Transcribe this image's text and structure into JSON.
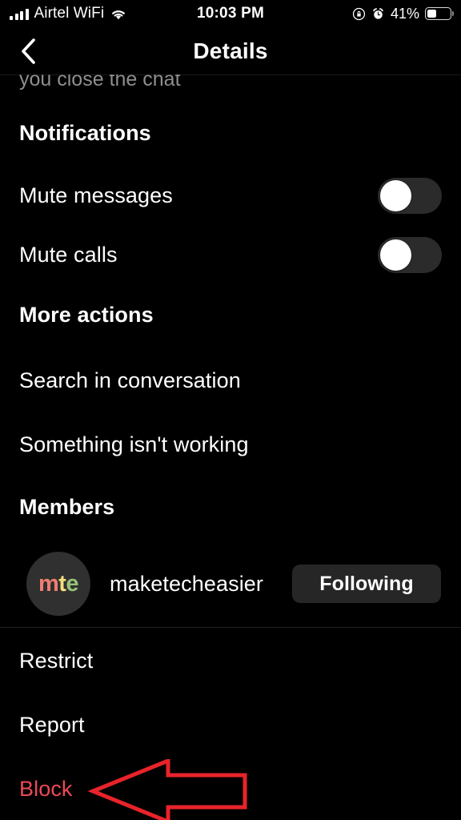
{
  "status_bar": {
    "carrier": "Airtel WiFi",
    "time": "10:03 PM",
    "battery_percent": "41%",
    "battery_level": 41,
    "icons": [
      "cellular-signal-icon",
      "wifi-icon",
      "orientation-lock-icon",
      "alarm-clock-icon",
      "battery-icon"
    ]
  },
  "header": {
    "title": "Details",
    "back_icon": "chevron-left-icon"
  },
  "content": {
    "clipped_text": "you close the chat",
    "sections": [
      {
        "heading": "Notifications",
        "rows": [
          {
            "label": "Mute messages",
            "control": "toggle",
            "value": "off"
          },
          {
            "label": "Mute calls",
            "control": "toggle",
            "value": "off"
          }
        ]
      },
      {
        "heading": "More actions",
        "rows": [
          {
            "label": "Search in conversation",
            "control": "none"
          },
          {
            "label": "Something isn't working",
            "control": "none"
          }
        ]
      },
      {
        "heading": "Members",
        "member": {
          "avatar_initials": [
            "m",
            "t",
            "e"
          ],
          "username": "maketecheasier",
          "follow_state": "Following"
        }
      }
    ],
    "footer_actions": [
      {
        "label": "Restrict",
        "style": "normal"
      },
      {
        "label": "Report",
        "style": "normal"
      },
      {
        "label": "Block",
        "style": "danger"
      }
    ]
  },
  "annotation": {
    "type": "arrow",
    "direction": "left",
    "color": "#e8232a",
    "points_to": "Block"
  },
  "colors": {
    "background": "#000000",
    "text_primary": "#ffffff",
    "text_secondary": "#8e8e8e",
    "danger": "#ed4956",
    "button_bg": "#262626",
    "toggle_track": "#2b2b2b",
    "annotation_red": "#e8232a"
  }
}
